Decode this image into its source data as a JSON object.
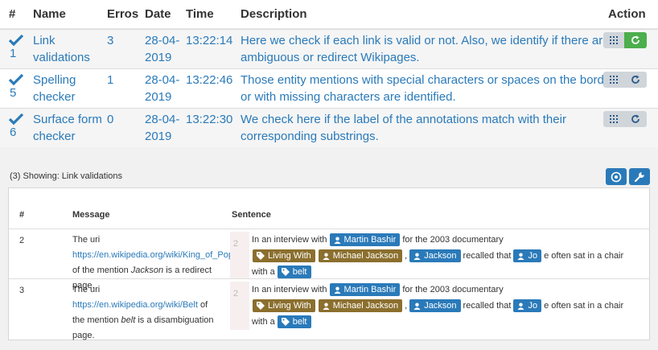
{
  "validations": {
    "headers": {
      "num": "#",
      "name": "Name",
      "errors": "Erros",
      "date": "Date",
      "time": "Time",
      "description": "Description",
      "action": "Action"
    },
    "rows": [
      {
        "num": "1",
        "name_line1": "Link",
        "name_line2": "validations",
        "errors": "3",
        "date_line1": "28-04-",
        "date_line2": "2019",
        "time": "13:22:14",
        "desc_line1": "Here we check if each link is valid or not. Also, we identify if there are",
        "desc_line2": "ambiguous or redirect Wikipages.",
        "status_icon": "check-icon"
      },
      {
        "num": "5",
        "name_line1": "Spelling",
        "name_line2": "checker",
        "errors": "1",
        "date_line1": "28-04-",
        "date_line2": "2019",
        "time": "13:22:46",
        "desc_line1": "Those entity mentions with special characters or spaces on the borders,",
        "desc_line2": "or with missing characters are identified.",
        "status_icon": "check-icon"
      },
      {
        "num": "6",
        "name_line1": "Surface form",
        "name_line2": "checker",
        "errors": "0",
        "date_line1": "28-04-",
        "date_line2": "2019",
        "time": "13:22:30",
        "desc_line1": "We check here if the label of the annotations match with their",
        "desc_line2": "corresponding substrings.",
        "status_icon": "check-icon"
      }
    ],
    "action_icons": [
      "grid-icon",
      "refresh-icon"
    ]
  },
  "showing_label": "(3) Showing: Link validations",
  "tool_icons": [
    "target-icon",
    "wrench-icon"
  ],
  "details": {
    "headers": {
      "num": "#",
      "message": "Message",
      "sentence": "Sentence"
    },
    "rows": [
      {
        "num": "2",
        "msg_prefix": "The uri",
        "msg_link": "https://en.wikipedia.org/wiki/King_of_Pop",
        "msg_pre_mention": "of the mention ",
        "msg_mention": "Jackson",
        "msg_suffix": " is a redirect page.",
        "line_no": "2"
      },
      {
        "num": "3",
        "msg_prefix": "The uri ",
        "msg_link": "https://en.wikipedia.org/wiki/Belt",
        "msg_link_suffix": " of",
        "msg_pre_mention": "the mention ",
        "msg_mention": "belt",
        "msg_suffix": " is a disambiguation page.",
        "line_no": "2"
      }
    ],
    "sentence": {
      "t1": "In an interview with",
      "tag_martin": "Martin Bashir",
      "t2": "for the 2003 documentary",
      "tag_living": "Living With",
      "tag_michael": "Michael Jackson",
      "comma": ",",
      "tag_jackson": "Jackson",
      "t3": "recalled that",
      "tag_jo": "Jo",
      "t4": "e often sat in a chair",
      "t5": "with a",
      "tag_belt": "belt"
    },
    "colors": {
      "person_tag": "#2a7ab9",
      "work_tag": "#8b6f2e",
      "link": "#2a7ab9"
    }
  }
}
